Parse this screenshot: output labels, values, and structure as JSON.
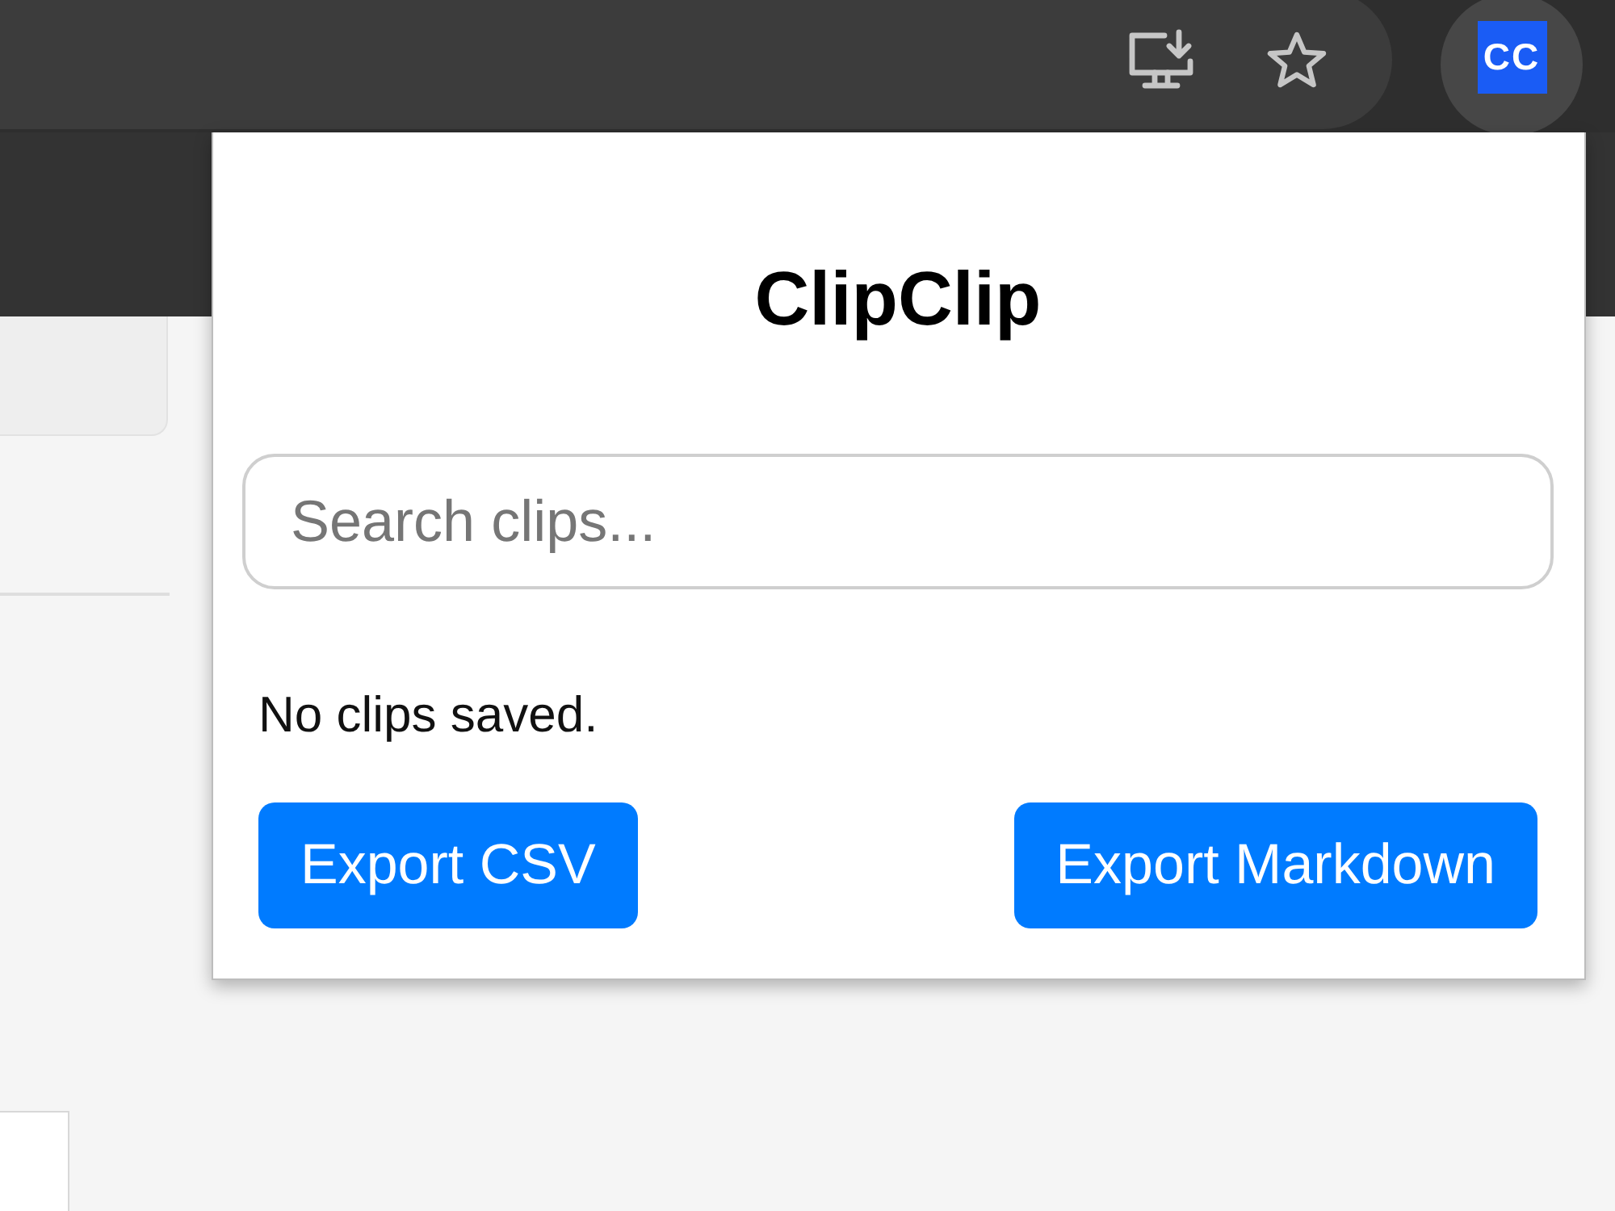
{
  "toolbar": {
    "extension": {
      "label": "CC"
    }
  },
  "popup": {
    "title": "ClipClip",
    "search": {
      "placeholder": "Search clips..."
    },
    "empty_message": "No clips saved.",
    "buttons": [
      "Export CSV",
      "Export Markdown"
    ]
  }
}
